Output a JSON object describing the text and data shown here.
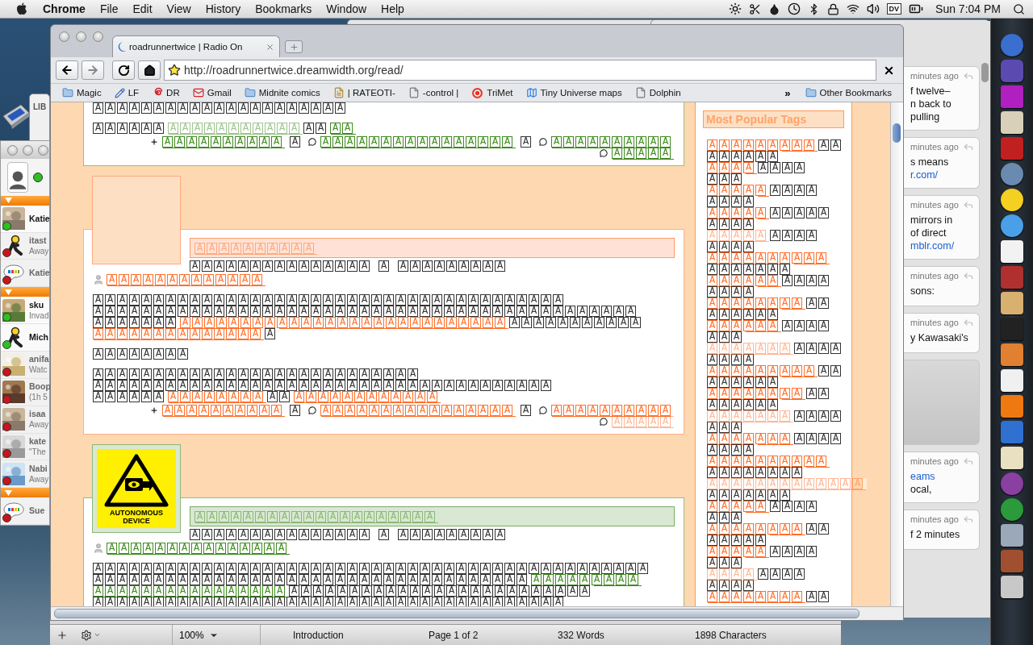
{
  "menubar": {
    "app": "Chrome",
    "menus": [
      "File",
      "Edit",
      "View",
      "History",
      "Bookmarks",
      "Window",
      "Help"
    ],
    "input_badge": "DV",
    "clock": "Sun 7:04 PM"
  },
  "desktop": {
    "window_label": "LIB"
  },
  "buddy_list": {
    "groups": [
      {
        "expanded": true,
        "contacts": [
          {
            "name": "Katie",
            "online": true
          },
          {
            "name": "itast",
            "status": "Away",
            "kind": "aim",
            "online": false
          },
          {
            "name": "Katie",
            "kind": "talk",
            "online": false
          }
        ]
      },
      {
        "expanded": true,
        "contacts": [
          {
            "name": "sku",
            "status": "Invad",
            "online": true
          },
          {
            "name": "Mich",
            "kind": "aim",
            "online": true
          },
          {
            "name": "anifa",
            "status": "Watc",
            "online": false
          },
          {
            "name": "Boop",
            "status": "(1h 5",
            "online": false
          },
          {
            "name": "isaa",
            "status": "Away",
            "online": false
          },
          {
            "name": "kate",
            "status": "\"The",
            "online": false
          },
          {
            "name": "Nabi",
            "status": "Away",
            "online": false
          }
        ]
      },
      {
        "expanded": true,
        "contacts": [
          {
            "name": "Sue",
            "kind": "talk",
            "online": false
          }
        ]
      }
    ]
  },
  "timeline": {
    "cards": [
      {
        "kind": "tweet",
        "time": "minutes ago",
        "lines": [
          {
            "text": "f twelve–",
            "link": false
          },
          {
            "text": "n back to",
            "link": false
          },
          {
            "text": "pulling",
            "link": false
          }
        ]
      },
      {
        "kind": "tweet",
        "time": "minutes ago",
        "lines": [
          {
            "text": "s means",
            "link": false
          },
          {
            "text": "r.com/",
            "link": true
          }
        ]
      },
      {
        "kind": "tweet",
        "time": "minutes ago",
        "lines": [
          {
            "text": "mirrors in",
            "link": false
          },
          {
            "text": "of direct",
            "link": false
          },
          {
            "text": "mblr.com/",
            "link": true
          }
        ]
      },
      {
        "kind": "tweet",
        "time": "minutes ago",
        "lines": [
          {
            "text": "sons:",
            "link": false
          }
        ]
      },
      {
        "kind": "tweet",
        "time": "minutes ago",
        "lines": [
          {
            "text": "y Kawasaki's",
            "link": false
          }
        ]
      },
      {
        "kind": "blank"
      },
      {
        "kind": "tweet",
        "time": "minutes ago",
        "lines": [
          {
            "text": "eams",
            "link": true
          },
          {
            "text": "ocal,",
            "link": false
          }
        ]
      },
      {
        "kind": "tweet",
        "time": "minutes ago",
        "lines": [
          {
            "text": "f 2 minutes",
            "link": false
          }
        ]
      }
    ]
  },
  "editor_status": {
    "zoom": "100%",
    "section": "Introduction",
    "page": "Page 1 of 2",
    "words": "332 Words",
    "characters": "1898 Characters"
  },
  "browser": {
    "tab": {
      "title": "roadrunnertwice | Radio On"
    },
    "url": "http://roadrunnertwice.dreamwidth.org/read/",
    "bookmarks": [
      {
        "label": "Magic",
        "kind": "folder"
      },
      {
        "label": "LF",
        "kind": "pencil"
      },
      {
        "label": "DR",
        "kind": "spiral"
      },
      {
        "label": "Gmail",
        "kind": "mail"
      },
      {
        "label": "Midnite comics",
        "kind": "folder"
      },
      {
        "label": "| RATEOTI-",
        "kind": "note"
      },
      {
        "label": "-control |",
        "kind": "page"
      },
      {
        "label": "TriMet",
        "kind": "ring"
      },
      {
        "label": "Tiny Universe maps",
        "kind": "map"
      },
      {
        "label": "Dolphin",
        "kind": "page"
      }
    ],
    "bookmarks_overflow": "»",
    "other_bookmarks": "Other Bookmarks",
    "entries": [
      {
        "color": "#3f8a1f",
        "paragraphs": [
          [
            [
              {
                "kind": "plain",
                "text": "AAAAAAAAAAAAAAAAAAAAA"
              }
            ]
          ],
          [
            [
              {
                "kind": "plain",
                "text": "AAAAAA"
              },
              {
                "kind": "faded",
                "text": "AAAAAAAAAAA"
              },
              {
                "kind": "plain",
                "text": "AA"
              },
              {
                "kind": "link",
                "text": "AA"
              }
            ]
          ]
        ],
        "footer": [
          [
            {
              "kind": "plus_link",
              "text": "AAAAAAAAAA"
            },
            {
              "kind": "plain",
              "text": "A"
            },
            {
              "kind": "comment_link",
              "text": "AAAAAAAAAAAAAAAA"
            },
            {
              "kind": "plain",
              "text": "A"
            },
            {
              "kind": "comment_link",
              "text": "AAAAAAAAAA"
            }
          ],
          [
            {
              "kind": "comment_link",
              "text": "AAAAA"
            }
          ]
        ]
      },
      {
        "color": "#ff6f2b",
        "userpic": {
          "kind": "blank"
        },
        "subject": "AAAAAAAAAA",
        "date": [
          "AAAAAAAAAAAAAAA",
          "A",
          "AAAAAAAAA"
        ],
        "poster": "AAAAAAAAAAAAA",
        "paragraphs": [
          [
            [
              {
                "kind": "plain",
                "text": "AAAAAAAAAAAAAAAAAAAAAAAAAAAAAAAAAAAAAAA"
              }
            ],
            [
              {
                "kind": "plain",
                "text": "AAAAAAAAAAAAAAAAAAAAAAAAAAAAAAAAAAAAAAAAAAAAA"
              }
            ],
            [
              {
                "kind": "plain",
                "text": "AAAAAAA"
              },
              {
                "kind": "link",
                "text": "AAAAAAAAAAAAAAAAAAAAAAAAAAA"
              },
              {
                "kind": "plain",
                "text": "AAAAAAAAAAA"
              }
            ],
            [
              {
                "kind": "link",
                "text": "AAAAAAAAAAAAAA"
              },
              {
                "kind": "plain",
                "text": "A"
              }
            ]
          ],
          [
            [
              {
                "kind": "plain",
                "text": "AAAAAAAA"
              }
            ]
          ],
          [
            [
              {
                "kind": "plain",
                "text": "AAAAAAAAAAAAAAAAAAAAAAAAAAA"
              }
            ],
            [
              {
                "kind": "plain",
                "text": "AAAAAAAAAAAAAAAAAAAAAAAAAAAAAAAAAAAAAA"
              }
            ],
            [
              {
                "kind": "plain",
                "text": "AAAAAA"
              },
              {
                "kind": "link",
                "text": "AAAAAAAA"
              },
              {
                "kind": "plain",
                "text": "AA"
              },
              {
                "kind": "link",
                "text": "AAAAAAAAAAAA"
              }
            ]
          ]
        ],
        "footer": [
          [
            {
              "kind": "plus_link",
              "text": "AAAAAAAAAA"
            },
            {
              "kind": "plain",
              "text": "A"
            },
            {
              "kind": "comment_link",
              "text": "AAAAAAAAAAAAAAAA"
            },
            {
              "kind": "plain",
              "text": "A"
            },
            {
              "kind": "comment_link",
              "text": "AAAAAAAAAA"
            }
          ],
          [
            {
              "kind": "comment_faded",
              "text": "AAAAA"
            }
          ]
        ]
      },
      {
        "color": "#3f8a1f",
        "userpic": {
          "kind": "sign",
          "caption": "AUTONOMOUS DEVICE"
        },
        "subject": "AAAAAAAAAAAAAAAAAAAA",
        "date": [
          "AAAAAAAAAAAAAAA",
          "A",
          "AAAAAAAAA"
        ],
        "poster": "AAAAAAAAAAAAAAA",
        "paragraphs": [
          [
            [
              {
                "kind": "plain",
                "text": "AAAAAAAAAAAAAAAAAAAAAAAAAAAAAAAAAAAAAAAAAAAAAA"
              }
            ],
            [
              {
                "kind": "plain",
                "text": "AAAAAAAAAAAAAAAAAAAAAAAAAAAAAAAAAAAA"
              },
              {
                "kind": "link",
                "text": "AAAAAAAAA"
              }
            ],
            [
              {
                "kind": "link",
                "text": "AAAAAAAAAAAAAAAA"
              },
              {
                "kind": "plain",
                "text": "AAAAAAAAAAAAAAAAAAAAAAAAA"
              }
            ],
            [
              {
                "kind": "plain",
                "text": "AAAAAAAAAAAAAAAAAAAAAAAAAAAAAAAAAAAAAAA"
              }
            ]
          ]
        ]
      }
    ],
    "sidebar": {
      "title": "Most Popular Tags",
      "tags": [
        {
          "name": "AAAAAAAAA",
          "extra": "AA",
          "count": "AAAAAA",
          "visited": false
        },
        {
          "name": "AAAA",
          "extra": "AAAA",
          "count": "AAA",
          "visited": false
        },
        {
          "name": "AAAAA",
          "extra": "AAAA",
          "count": "AAAA",
          "visited": false
        },
        {
          "name": "AAAAA",
          "extra": "AAAAA",
          "count": "AAAA",
          "visited": false
        },
        {
          "name": "AAAAA",
          "extra": "AAAA",
          "count": "AAAA",
          "visited": true
        },
        {
          "name": "AAAAAAAAAA",
          "count": "AAAAAAA",
          "visited": false
        },
        {
          "name": "AAAAAA",
          "extra": "AAAA",
          "count": "AAAA",
          "visited": false
        },
        {
          "name": "AAAAAAAA",
          "extra": "AA",
          "count": "AAAAAA",
          "visited": false
        },
        {
          "name": "AAAAAA",
          "extra": "AAAA",
          "count": "AAA",
          "visited": false
        },
        {
          "name": "AAAAAAA",
          "extra": "AAAA",
          "count": "AAAA",
          "visited": true
        },
        {
          "name": "AAAAAAAAA",
          "extra": "AA",
          "count": "AAAAAA",
          "visited": false
        },
        {
          "name": "AAAAAAAA",
          "extra": "AA",
          "count": "AAAAAA",
          "visited": false
        },
        {
          "name": "AAAAAAA",
          "extra": "AAAA",
          "count": "AAA",
          "visited": true
        },
        {
          "name": "AAAAAAA",
          "extra": "AAAA",
          "count": "AAAA",
          "visited": false
        },
        {
          "name": "AAAAAAAAAA",
          "count": "AAAAAAAA",
          "visited": false
        },
        {
          "name": "AAAAAAAAAAAAA",
          "count": "AAAAAAA",
          "visited": true
        },
        {
          "name": "AAAAA",
          "extra": "AAAA",
          "count": "AAA",
          "visited": false
        },
        {
          "name": "AAAAAAAA",
          "extra": "AA",
          "count": "AAAAA",
          "visited": false
        },
        {
          "name": "AAAAA",
          "extra": "AAAA",
          "count": "AAA",
          "visited": false
        },
        {
          "name": "AAAA",
          "extra": "AAAA",
          "count": "AAAA",
          "visited": true
        },
        {
          "name": "AAAAAAAA",
          "extra": "AA",
          "visited": false
        }
      ]
    }
  }
}
